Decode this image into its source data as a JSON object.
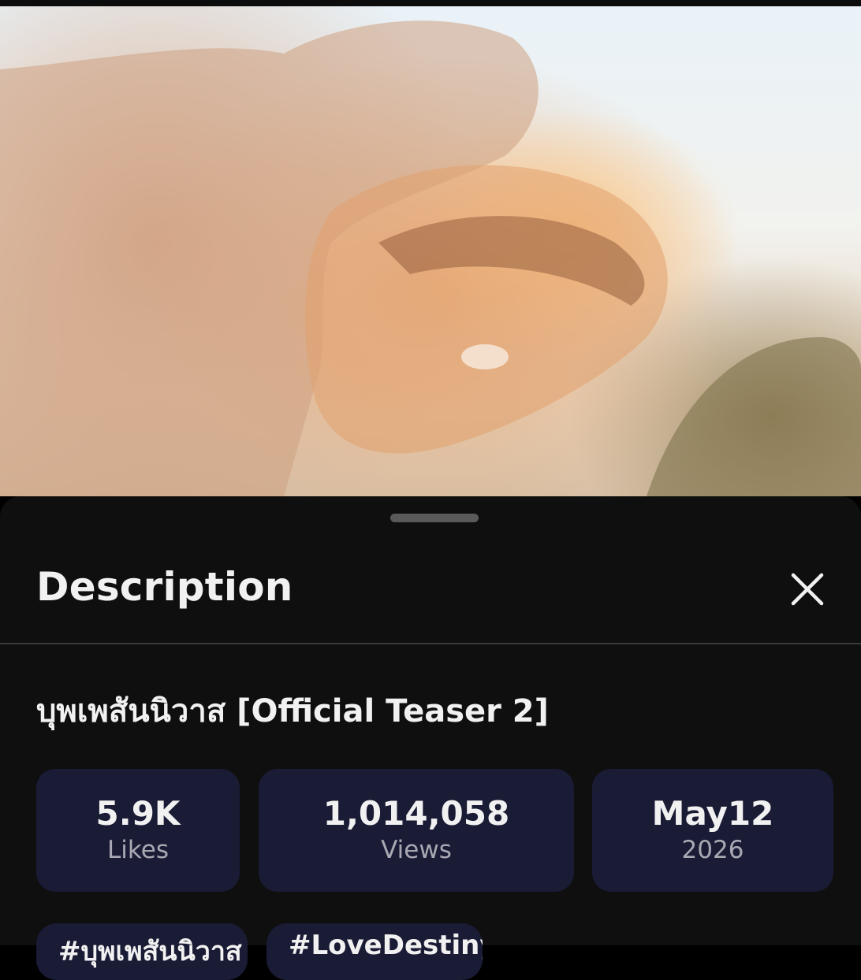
{
  "video": {
    "thumbnail_description_icon": "video-frame",
    "progress_fraction": 0.535,
    "buffered_fraction": 0.744
  },
  "sheet": {
    "title": "Description",
    "close_icon": "close-icon"
  },
  "details": {
    "video_title": "บุพเพสันนิวาส [Official Teaser 2]",
    "stats": [
      {
        "value": "5.9K",
        "label": "Likes"
      },
      {
        "value": "1,014,058",
        "label": "Views"
      },
      {
        "value": "May12",
        "label": "2026"
      }
    ],
    "hashtags": [
      "#บุพเพสันนิวาส",
      "#LoveDestiny"
    ]
  },
  "colors": {
    "sheet_bg": "#0f0f0f",
    "card_bg": "#1a1b35",
    "text_primary": "#f1f1f1",
    "text_secondary": "#a9a9b4"
  }
}
